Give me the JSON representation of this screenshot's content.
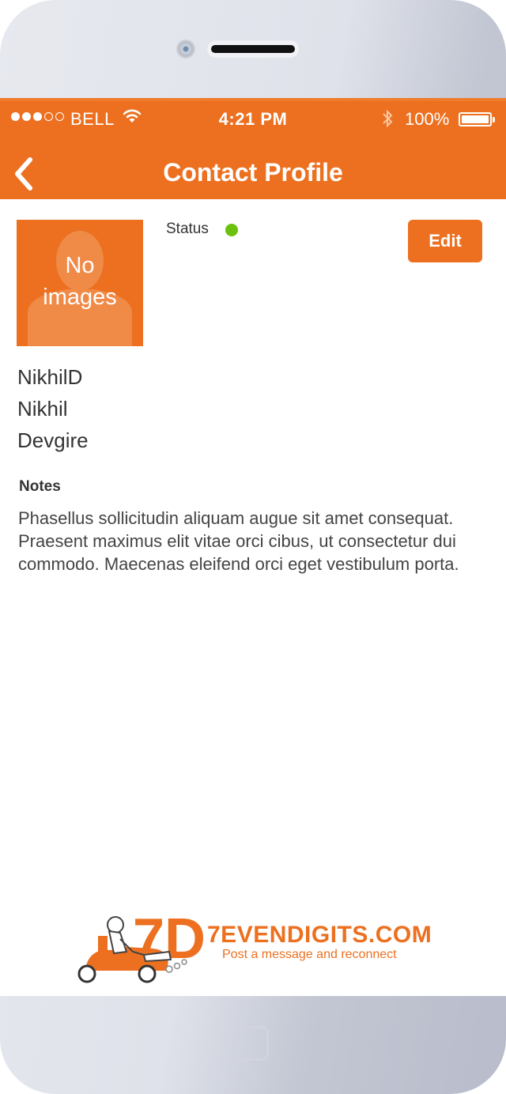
{
  "status_bar": {
    "signal_bars_filled": 3,
    "signal_bars_total": 5,
    "carrier": "BELL",
    "time": "4:21 PM",
    "battery": "100%"
  },
  "nav": {
    "back_icon": "chevron-left-icon",
    "title": "Contact Profile"
  },
  "profile": {
    "avatar_placeholder": "No\nimages",
    "status_label": "Status",
    "status_color": "#6cc10c",
    "edit_label": "Edit",
    "username": "NikhilD",
    "first_name": "Nikhil",
    "last_name": "Devgire"
  },
  "notes": {
    "label": "Notes",
    "text": "Phasellus sollicitudin aliquam augue sit amet consequat. Praesent maximus elit vitae orci cibus, ut consectetur dui commodo. Maecenas eleifend orci eget vestibulum porta."
  },
  "branding": {
    "brand": "7EVENDIGITS.COM",
    "tagline": "Post a message and reconnect"
  },
  "colors": {
    "accent": "#ec7020",
    "status_online": "#6cc10c"
  }
}
